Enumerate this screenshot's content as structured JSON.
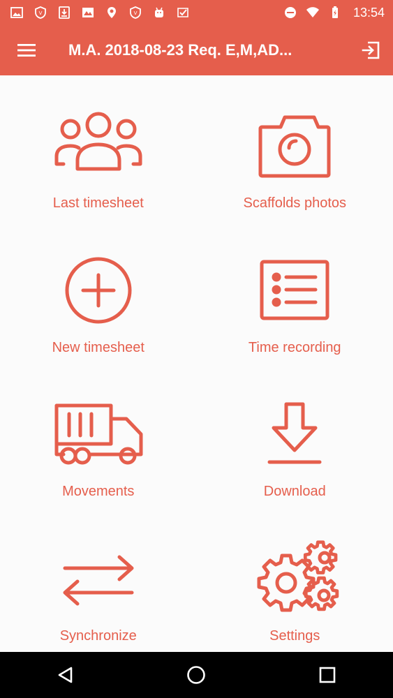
{
  "status_bar": {
    "time": "13:54",
    "left_icons": [
      "image-icon",
      "shield-icon",
      "download-icon",
      "gallery-icon",
      "location-icon",
      "shield-icon",
      "android-icon",
      "check-icon"
    ],
    "right_icons": [
      "dnd-icon",
      "wifi-icon",
      "battery-icon"
    ]
  },
  "app_bar": {
    "title": "M.A. 2018-08-23 Req. E,M,AD...",
    "menu_icon": "hamburger-icon",
    "action_icon": "logout-icon"
  },
  "menu": {
    "items": [
      {
        "label": "Last timesheet",
        "icon": "group-icon"
      },
      {
        "label": "Scaffolds photos",
        "icon": "camera-icon"
      },
      {
        "label": "New timesheet",
        "icon": "add-circle-icon"
      },
      {
        "label": "Time recording",
        "icon": "list-icon"
      },
      {
        "label": "Movements",
        "icon": "truck-icon"
      },
      {
        "label": "Download",
        "icon": "download-icon"
      },
      {
        "label": "Synchronize",
        "icon": "sync-arrows-icon"
      },
      {
        "label": "Settings",
        "icon": "gears-icon"
      }
    ]
  },
  "colors": {
    "accent": "#e55e4c",
    "background": "#fbfbfb",
    "nav_bar": "#000000"
  }
}
